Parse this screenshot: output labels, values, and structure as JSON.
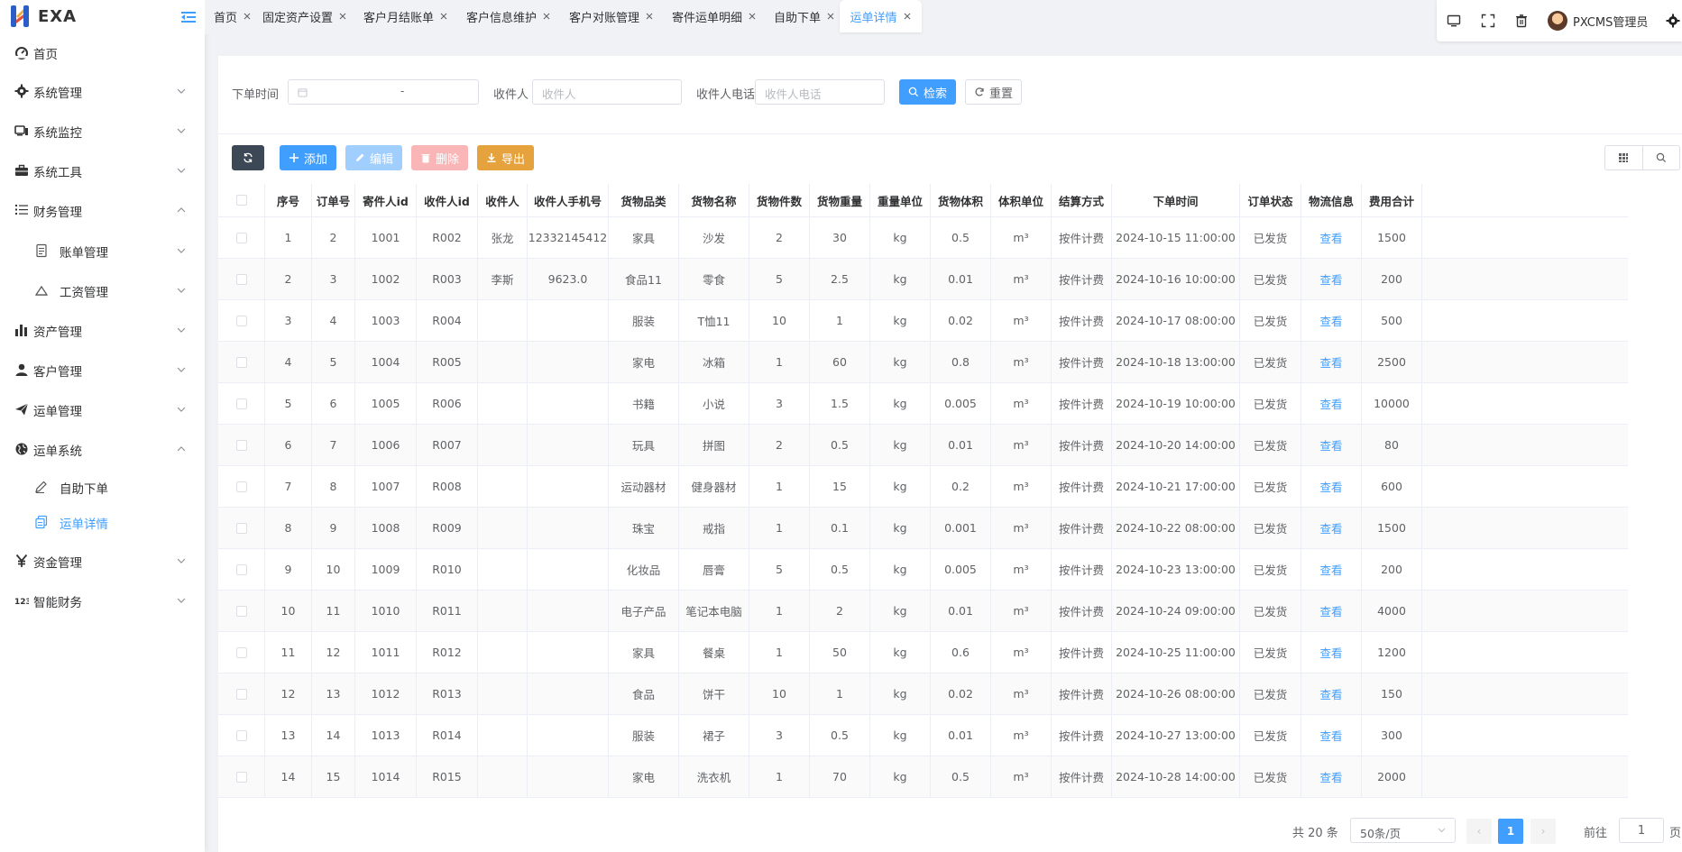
{
  "app": {
    "logo_text": "EXA"
  },
  "sidebar": {
    "items": [
      {
        "name": "home",
        "label": "首页",
        "icon": "dashboard-icon"
      },
      {
        "name": "system",
        "label": "系统管理",
        "icon": "gear-icon",
        "arrow": "down"
      },
      {
        "name": "monitor",
        "label": "系统监控",
        "icon": "monitor-icon",
        "arrow": "down"
      },
      {
        "name": "tools",
        "label": "系统工具",
        "icon": "toolbox-icon",
        "arrow": "down"
      },
      {
        "name": "finance",
        "label": "财务管理",
        "icon": "list-icon",
        "arrow": "up"
      },
      {
        "name": "bill",
        "label": "账单管理",
        "icon": "document-icon",
        "arrow": "down",
        "sub": true
      },
      {
        "name": "salary",
        "label": "工资管理",
        "icon": "triangle-icon",
        "arrow": "down",
        "sub": true
      },
      {
        "name": "assets",
        "label": "资产管理",
        "icon": "bar-chart-icon",
        "arrow": "down"
      },
      {
        "name": "customer",
        "label": "客户管理",
        "icon": "user-icon",
        "arrow": "down"
      },
      {
        "name": "waybill",
        "label": "运单管理",
        "icon": "send-icon",
        "arrow": "down"
      },
      {
        "name": "waybill-system",
        "label": "运单系统",
        "icon": "globe-icon",
        "arrow": "up"
      },
      {
        "name": "self-order",
        "label": "自助下单",
        "icon": "pen-icon",
        "sub": true
      },
      {
        "name": "waybill-detail",
        "label": "运单详情",
        "icon": "copy-icon",
        "sub": true,
        "active": true
      },
      {
        "name": "funds",
        "label": "资金管理",
        "icon": "yen-icon",
        "arrow": "down"
      },
      {
        "name": "smart-finance",
        "label": "智能财务",
        "icon": "numbers-icon",
        "arrow": "down"
      }
    ]
  },
  "tabs": [
    {
      "label": "首页"
    },
    {
      "label": "固定资产设置"
    },
    {
      "label": "客户月结账单"
    },
    {
      "label": "客户信息维护"
    },
    {
      "label": "客户对账管理"
    },
    {
      "label": "寄件运单明细"
    },
    {
      "label": "自助下单"
    },
    {
      "label": "运单详情",
      "active": true
    }
  ],
  "header": {
    "user_name": "PXCMS管理员"
  },
  "search": {
    "order_time_label": "下单时间",
    "date_separator": "-",
    "receiver_label": "收件人",
    "receiver_placeholder": "收件人",
    "receiver_phone_label": "收件人电话",
    "receiver_phone_placeholder": "收件人电话",
    "search_button": "检索",
    "reset_button": "重置"
  },
  "toolbar": {
    "add_button": "添加",
    "edit_button": "编辑",
    "delete_button": "删除",
    "export_button": "导出"
  },
  "table": {
    "columns": [
      "序号",
      "订单号",
      "寄件人id",
      "收件人id",
      "收件人",
      "收件人手机号",
      "货物品类",
      "货物名称",
      "货物件数",
      "货物重量",
      "重量单位",
      "货物体积",
      "体积单位",
      "结算方式",
      "下单时间",
      "订单状态",
      "物流信息",
      "费用合计"
    ],
    "rows": [
      [
        "1",
        "2",
        "1001",
        "R002",
        "张龙",
        "12332145412",
        "家具",
        "沙发",
        "2",
        "30",
        "kg",
        "0.5",
        "m³",
        "按件计费",
        "2024-10-15 11:00:00",
        "已发货",
        "查看",
        "1500"
      ],
      [
        "2",
        "3",
        "1002",
        "R003",
        "李斯",
        "9623.0",
        "食品11",
        "零食",
        "5",
        "2.5",
        "kg",
        "0.01",
        "m³",
        "按件计费",
        "2024-10-16 10:00:00",
        "已发货",
        "查看",
        "200"
      ],
      [
        "3",
        "4",
        "1003",
        "R004",
        "",
        "",
        "服装",
        "T恤11",
        "10",
        "1",
        "kg",
        "0.02",
        "m³",
        "按件计费",
        "2024-10-17 08:00:00",
        "已发货",
        "查看",
        "500"
      ],
      [
        "4",
        "5",
        "1004",
        "R005",
        "",
        "",
        "家电",
        "冰箱",
        "1",
        "60",
        "kg",
        "0.8",
        "m³",
        "按件计费",
        "2024-10-18 13:00:00",
        "已发货",
        "查看",
        "2500"
      ],
      [
        "5",
        "6",
        "1005",
        "R006",
        "",
        "",
        "书籍",
        "小说",
        "3",
        "1.5",
        "kg",
        "0.005",
        "m³",
        "按件计费",
        "2024-10-19 10:00:00",
        "已发货",
        "查看",
        "10000"
      ],
      [
        "6",
        "7",
        "1006",
        "R007",
        "",
        "",
        "玩具",
        "拼图",
        "2",
        "0.5",
        "kg",
        "0.01",
        "m³",
        "按件计费",
        "2024-10-20 14:00:00",
        "已发货",
        "查看",
        "80"
      ],
      [
        "7",
        "8",
        "1007",
        "R008",
        "",
        "",
        "运动器材",
        "健身器材",
        "1",
        "15",
        "kg",
        "0.2",
        "m³",
        "按件计费",
        "2024-10-21 17:00:00",
        "已发货",
        "查看",
        "600"
      ],
      [
        "8",
        "9",
        "1008",
        "R009",
        "",
        "",
        "珠宝",
        "戒指",
        "1",
        "0.1",
        "kg",
        "0.001",
        "m³",
        "按件计费",
        "2024-10-22 08:00:00",
        "已发货",
        "查看",
        "1500"
      ],
      [
        "9",
        "10",
        "1009",
        "R010",
        "",
        "",
        "化妆品",
        "唇膏",
        "5",
        "0.5",
        "kg",
        "0.005",
        "m³",
        "按件计费",
        "2024-10-23 13:00:00",
        "已发货",
        "查看",
        "200"
      ],
      [
        "10",
        "11",
        "1010",
        "R011",
        "",
        "",
        "电子产品",
        "笔记本电脑",
        "1",
        "2",
        "kg",
        "0.01",
        "m³",
        "按件计费",
        "2024-10-24 09:00:00",
        "已发货",
        "查看",
        "4000"
      ],
      [
        "11",
        "12",
        "1011",
        "R012",
        "",
        "",
        "家具",
        "餐桌",
        "1",
        "50",
        "kg",
        "0.6",
        "m³",
        "按件计费",
        "2024-10-25 11:00:00",
        "已发货",
        "查看",
        "1200"
      ],
      [
        "12",
        "13",
        "1012",
        "R013",
        "",
        "",
        "食品",
        "饼干",
        "10",
        "1",
        "kg",
        "0.02",
        "m³",
        "按件计费",
        "2024-10-26 08:00:00",
        "已发货",
        "查看",
        "150"
      ],
      [
        "13",
        "14",
        "1013",
        "R014",
        "",
        "",
        "服装",
        "裙子",
        "3",
        "0.5",
        "kg",
        "0.01",
        "m³",
        "按件计费",
        "2024-10-27 13:00:00",
        "已发货",
        "查看",
        "300"
      ],
      [
        "14",
        "15",
        "1014",
        "R015",
        "",
        "",
        "家电",
        "洗衣机",
        "1",
        "70",
        "kg",
        "0.5",
        "m³",
        "按件计费",
        "2024-10-28 14:00:00",
        "已发货",
        "查看",
        "2000"
      ]
    ]
  },
  "pagination": {
    "total_text": "共 20 条",
    "page_size": "50条/页",
    "prev": "‹",
    "current_page": "1",
    "next": "›",
    "goto_label": "前往",
    "goto_value": "1",
    "page_unit": "页"
  },
  "colors": {
    "primary": "#409eff",
    "dark": "#3c4856",
    "warning": "#e6a23c",
    "danger_light": "#fab6b6",
    "primary_light": "#a0cfff"
  }
}
